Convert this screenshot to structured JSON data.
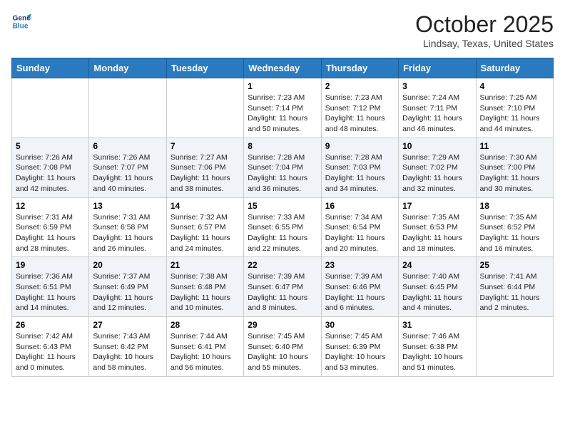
{
  "header": {
    "logo_line1": "General",
    "logo_line2": "Blue",
    "month": "October 2025",
    "location": "Lindsay, Texas, United States"
  },
  "days_of_week": [
    "Sunday",
    "Monday",
    "Tuesday",
    "Wednesday",
    "Thursday",
    "Friday",
    "Saturday"
  ],
  "weeks": [
    [
      {
        "day": "",
        "info": ""
      },
      {
        "day": "",
        "info": ""
      },
      {
        "day": "",
        "info": ""
      },
      {
        "day": "1",
        "info": "Sunrise: 7:23 AM\nSunset: 7:14 PM\nDaylight: 11 hours\nand 50 minutes."
      },
      {
        "day": "2",
        "info": "Sunrise: 7:23 AM\nSunset: 7:12 PM\nDaylight: 11 hours\nand 48 minutes."
      },
      {
        "day": "3",
        "info": "Sunrise: 7:24 AM\nSunset: 7:11 PM\nDaylight: 11 hours\nand 46 minutes."
      },
      {
        "day": "4",
        "info": "Sunrise: 7:25 AM\nSunset: 7:10 PM\nDaylight: 11 hours\nand 44 minutes."
      }
    ],
    [
      {
        "day": "5",
        "info": "Sunrise: 7:26 AM\nSunset: 7:08 PM\nDaylight: 11 hours\nand 42 minutes."
      },
      {
        "day": "6",
        "info": "Sunrise: 7:26 AM\nSunset: 7:07 PM\nDaylight: 11 hours\nand 40 minutes."
      },
      {
        "day": "7",
        "info": "Sunrise: 7:27 AM\nSunset: 7:06 PM\nDaylight: 11 hours\nand 38 minutes."
      },
      {
        "day": "8",
        "info": "Sunrise: 7:28 AM\nSunset: 7:04 PM\nDaylight: 11 hours\nand 36 minutes."
      },
      {
        "day": "9",
        "info": "Sunrise: 7:28 AM\nSunset: 7:03 PM\nDaylight: 11 hours\nand 34 minutes."
      },
      {
        "day": "10",
        "info": "Sunrise: 7:29 AM\nSunset: 7:02 PM\nDaylight: 11 hours\nand 32 minutes."
      },
      {
        "day": "11",
        "info": "Sunrise: 7:30 AM\nSunset: 7:00 PM\nDaylight: 11 hours\nand 30 minutes."
      }
    ],
    [
      {
        "day": "12",
        "info": "Sunrise: 7:31 AM\nSunset: 6:59 PM\nDaylight: 11 hours\nand 28 minutes."
      },
      {
        "day": "13",
        "info": "Sunrise: 7:31 AM\nSunset: 6:58 PM\nDaylight: 11 hours\nand 26 minutes."
      },
      {
        "day": "14",
        "info": "Sunrise: 7:32 AM\nSunset: 6:57 PM\nDaylight: 11 hours\nand 24 minutes."
      },
      {
        "day": "15",
        "info": "Sunrise: 7:33 AM\nSunset: 6:55 PM\nDaylight: 11 hours\nand 22 minutes."
      },
      {
        "day": "16",
        "info": "Sunrise: 7:34 AM\nSunset: 6:54 PM\nDaylight: 11 hours\nand 20 minutes."
      },
      {
        "day": "17",
        "info": "Sunrise: 7:35 AM\nSunset: 6:53 PM\nDaylight: 11 hours\nand 18 minutes."
      },
      {
        "day": "18",
        "info": "Sunrise: 7:35 AM\nSunset: 6:52 PM\nDaylight: 11 hours\nand 16 minutes."
      }
    ],
    [
      {
        "day": "19",
        "info": "Sunrise: 7:36 AM\nSunset: 6:51 PM\nDaylight: 11 hours\nand 14 minutes."
      },
      {
        "day": "20",
        "info": "Sunrise: 7:37 AM\nSunset: 6:49 PM\nDaylight: 11 hours\nand 12 minutes."
      },
      {
        "day": "21",
        "info": "Sunrise: 7:38 AM\nSunset: 6:48 PM\nDaylight: 11 hours\nand 10 minutes."
      },
      {
        "day": "22",
        "info": "Sunrise: 7:39 AM\nSunset: 6:47 PM\nDaylight: 11 hours\nand 8 minutes."
      },
      {
        "day": "23",
        "info": "Sunrise: 7:39 AM\nSunset: 6:46 PM\nDaylight: 11 hours\nand 6 minutes."
      },
      {
        "day": "24",
        "info": "Sunrise: 7:40 AM\nSunset: 6:45 PM\nDaylight: 11 hours\nand 4 minutes."
      },
      {
        "day": "25",
        "info": "Sunrise: 7:41 AM\nSunset: 6:44 PM\nDaylight: 11 hours\nand 2 minutes."
      }
    ],
    [
      {
        "day": "26",
        "info": "Sunrise: 7:42 AM\nSunset: 6:43 PM\nDaylight: 11 hours\nand 0 minutes."
      },
      {
        "day": "27",
        "info": "Sunrise: 7:43 AM\nSunset: 6:42 PM\nDaylight: 10 hours\nand 58 minutes."
      },
      {
        "day": "28",
        "info": "Sunrise: 7:44 AM\nSunset: 6:41 PM\nDaylight: 10 hours\nand 56 minutes."
      },
      {
        "day": "29",
        "info": "Sunrise: 7:45 AM\nSunset: 6:40 PM\nDaylight: 10 hours\nand 55 minutes."
      },
      {
        "day": "30",
        "info": "Sunrise: 7:45 AM\nSunset: 6:39 PM\nDaylight: 10 hours\nand 53 minutes."
      },
      {
        "day": "31",
        "info": "Sunrise: 7:46 AM\nSunset: 6:38 PM\nDaylight: 10 hours\nand 51 minutes."
      },
      {
        "day": "",
        "info": ""
      }
    ]
  ]
}
